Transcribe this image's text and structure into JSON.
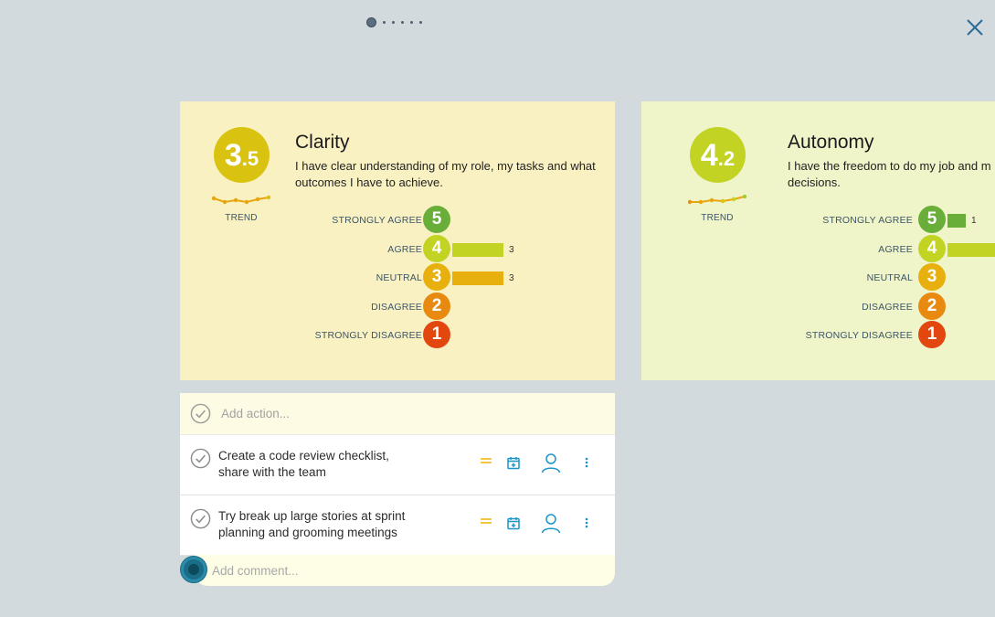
{
  "pagination": {
    "total": 6,
    "active": 0
  },
  "cards": [
    {
      "score_int": "3",
      "score_dec": ".5",
      "trend_label": "TREND",
      "title": "Clarity",
      "description": "I have clear understanding of my role, my tasks and what outcomes I have to achieve.",
      "scale": [
        {
          "label": "STRONGLY AGREE",
          "value": "5",
          "color": "#6aae3a",
          "count": "",
          "bar_fraction": 0
        },
        {
          "label": "AGREE",
          "value": "4",
          "color": "#c2d324",
          "count": "3",
          "bar_fraction": 1.0
        },
        {
          "label": "NEUTRAL",
          "value": "3",
          "color": "#e8b00e",
          "count": "3",
          "bar_fraction": 1.0
        },
        {
          "label": "DISAGREE",
          "value": "2",
          "color": "#e98a10",
          "count": "",
          "bar_fraction": 0
        },
        {
          "label": "STRONGLY DISAGREE",
          "value": "1",
          "color": "#e2470f",
          "count": "",
          "bar_fraction": 0
        }
      ]
    },
    {
      "score_int": "4",
      "score_dec": ".2",
      "trend_label": "TREND",
      "title": "Autonomy",
      "description": "I have the freedom to do my job and make decisions.",
      "desc_line1": "I have the freedom to do my job and m",
      "desc_line2": "decisions.",
      "scale": [
        {
          "label": "STRONGLY AGREE",
          "value": "5",
          "color": "#6aae3a",
          "count": "1",
          "bar_fraction": 0.33
        },
        {
          "label": "AGREE",
          "value": "4",
          "color": "#c2d324",
          "count": "",
          "bar_fraction": 1.0
        },
        {
          "label": "NEUTRAL",
          "value": "3",
          "color": "#e8b00e",
          "count": "",
          "bar_fraction": 0
        },
        {
          "label": "DISAGREE",
          "value": "2",
          "color": "#e98a10",
          "count": "",
          "bar_fraction": 0
        },
        {
          "label": "STRONGLY DISAGREE",
          "value": "1",
          "color": "#e2470f",
          "count": "",
          "bar_fraction": 0
        }
      ]
    }
  ],
  "actions": {
    "add_placeholder": "Add action...",
    "items": [
      {
        "line1": "Create a code review checklist,",
        "line2": "share with the team"
      },
      {
        "line1": "Try break up large stories at sprint",
        "line2": "planning and grooming meetings"
      }
    ]
  },
  "comment": {
    "placeholder": "Add comment..."
  },
  "colors": {
    "accent": "#1a95c9",
    "priority": "#f0b400"
  },
  "icons": [
    "close-icon",
    "check-circle-icon",
    "priority-equal-icon",
    "calendar-icon",
    "user-icon",
    "more-vertical-icon"
  ]
}
